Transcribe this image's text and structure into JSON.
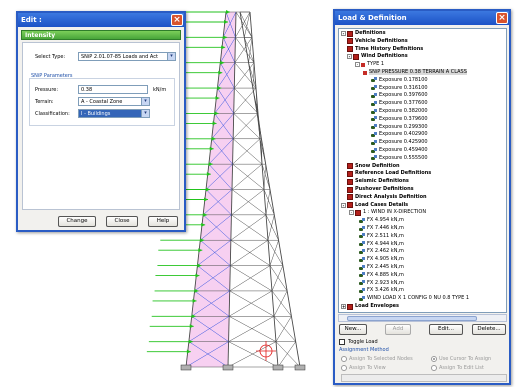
{
  "edit_dialog": {
    "title": "Edit :",
    "close_glyph": "×",
    "tab_label": "Intensity",
    "select_type_label": "Select Type:",
    "select_type_value": "SNiP 2.01.07-85 Loads and Act",
    "group_label": "SNiP Parameters",
    "pressure_label": "Pressure:",
    "pressure_value": "0.38",
    "pressure_unit": "kN/m",
    "terrain_label": "Terrain:",
    "terrain_value": "A - Coastal Zone",
    "classification_label": "Classification:",
    "classification_value": "I - Buildings",
    "buttons": {
      "change": "Change",
      "close": "Close",
      "help": "Help"
    },
    "dropdown_glyph": "▾"
  },
  "load_dialog": {
    "title": "Load & Definition",
    "close_glyph": "×",
    "tree": [
      {
        "text": "Definitions",
        "bold": true,
        "exp": "-",
        "icon": "red"
      },
      {
        "text": "Vehicle Definitions",
        "bold": true,
        "icon": "red"
      },
      {
        "text": "Time History Definitions",
        "bold": true,
        "icon": "red"
      },
      {
        "text": "Wind Definitions",
        "bold": true,
        "exp": "-",
        "icon": "red"
      },
      {
        "text": "TYPE 1",
        "exp": "-",
        "icon": "redsm"
      },
      {
        "text": "SNiP PRESSURE 0.38 TERRAIN A CLASS",
        "icon": "redsm",
        "selected": true
      },
      {
        "text": "Exposure 0.178100",
        "icon": "load"
      },
      {
        "text": "Exposure 0.316100",
        "icon": "load"
      },
      {
        "text": "Exposure 0.397600",
        "icon": "load"
      },
      {
        "text": "Exposure 0.377600",
        "icon": "load"
      },
      {
        "text": "Exposure 0.382000",
        "icon": "load"
      },
      {
        "text": "Exposure 0.379600",
        "icon": "load"
      },
      {
        "text": "Exposure 0.299300",
        "icon": "load"
      },
      {
        "text": "Exposure 0.402900",
        "icon": "load"
      },
      {
        "text": "Exposure 0.425900",
        "icon": "load"
      },
      {
        "text": "Exposure 0.459400",
        "icon": "load"
      },
      {
        "text": "Exposure 0.555500",
        "icon": "load"
      },
      {
        "text": "Snow Definition",
        "bold": true,
        "icon": "red"
      },
      {
        "text": "Reference Load Definitions",
        "bold": true,
        "icon": "red"
      },
      {
        "text": "Seismic Definitions",
        "bold": true,
        "icon": "red"
      },
      {
        "text": "Pushover Definitions",
        "bold": true,
        "icon": "red"
      },
      {
        "text": "Direct Analysis Definition",
        "bold": true,
        "icon": "red"
      },
      {
        "text": "Load Cases Details",
        "bold": true,
        "exp": "-",
        "icon": "red"
      },
      {
        "text": "1 : WIND IN X-DIRECTION",
        "exp": "-",
        "icon": "red"
      },
      {
        "text": "FX 4.954 kN,m",
        "icon": "load"
      },
      {
        "text": "FX 7.446 kN,m",
        "icon": "load"
      },
      {
        "text": "FX 2.511 kN,m",
        "icon": "load"
      },
      {
        "text": "FX 4.944 kN,m",
        "icon": "load"
      },
      {
        "text": "FX 2.462 kN,m",
        "icon": "load"
      },
      {
        "text": "FX 4.905 kN,m",
        "icon": "load"
      },
      {
        "text": "FX 2.445 kN,m",
        "icon": "load"
      },
      {
        "text": "FX 4.885 kN,m",
        "icon": "load"
      },
      {
        "text": "FX 2.923 kN,m",
        "icon": "load"
      },
      {
        "text": "FX 3.426 kN,m",
        "icon": "load"
      },
      {
        "text": "WIND LOAD X 1 CONFIG 0 NU 0.8 TYPE 1",
        "icon": "load"
      },
      {
        "text": "Load Envelopes",
        "bold": true,
        "exp": "+",
        "icon": "red"
      }
    ],
    "buttons": {
      "new": "New...",
      "add": "Add",
      "edit": "Edit...",
      "delete": "Delete..."
    },
    "toggle_load_label": "Toggle Load",
    "assignment_method_label": "Assignment Method",
    "radios": {
      "assign_selected": "Assign To Selected Nodes",
      "assign_view": "Assign To View",
      "use_cursor": "Use Cursor To Assign",
      "assign_edit_list": "Assign To Edit List"
    }
  },
  "model_view": {
    "line_color": "#4a4a4a",
    "bracing_color": "#3050e0",
    "wind_arrow_color": "#22c21c",
    "shade_color": "#e879d8",
    "cursor_color": "#e01818"
  }
}
